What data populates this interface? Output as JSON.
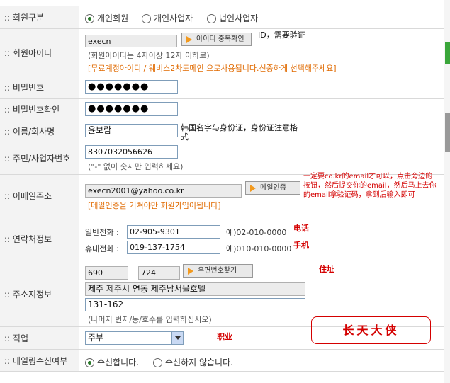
{
  "rows": {
    "member_type": {
      "label": ":: 회원구분",
      "options": [
        "개인회원",
        "개인사업자",
        "법인사업자"
      ],
      "selected": "개인회원"
    },
    "member_id": {
      "label": ":: 회원아이디",
      "value": "execn",
      "button": "아이디 중복확인",
      "hint": "(회원아이디는 4자이상 12자 이하로)",
      "warning": "[무료계정아이디 / 웨비스2차도메인 으로사용됩니다.신중하게 선택해주세요]",
      "annotation": "ID，需要验证"
    },
    "password": {
      "label": ":: 비밀번호",
      "value": "●●●●●●●"
    },
    "password_confirm": {
      "label": ":: 비밀번호확인",
      "value": "●●●●●●●"
    },
    "name": {
      "label": ":: 이름/회사명",
      "value": "윤보람",
      "annotation": "韩国名字与身份证，身份证注意格式"
    },
    "resident_no": {
      "label": ":: 주민/사업자번호",
      "value": "8307032056626",
      "hint": "(\"-\" 없이 숫자만 입력하세요)"
    },
    "email": {
      "label": ":: 이메일주소",
      "value": "execn2001@yahoo.co.kr",
      "button": "메일인증",
      "warning": "[메일인증을 거쳐야만 회원가입이됩니다]",
      "annotation": "一定要co.kr的email才可以，点击旁边的按钮，然后提交你的email，然后马上去你的email拿验证码，拿到后输入即可"
    },
    "contact": {
      "label": ":: 연락처정보",
      "phone_label": "일반전화 :",
      "phone_value": "02-905-9301",
      "phone_example": "예)02-010-0000",
      "phone_note": "电话",
      "mobile_label": "휴대전화 :",
      "mobile_value": "019-137-1754",
      "mobile_example": "예)010-010-0000",
      "mobile_note": "手机"
    },
    "address": {
      "label": ":: 주소지정보",
      "zip1": "690",
      "zip_sep": "-",
      "zip2": "724",
      "button": "우편번호찾기",
      "address1": "제주 제주시 연동 제주남서울호텔",
      "address2": "131-162",
      "hint": "(나머지 번지/동/호수를 입력하십시오)",
      "annotation": "住址"
    },
    "job": {
      "label": ":: 직업",
      "selected": "주부",
      "annotation": "职业"
    },
    "mailing": {
      "label": ":: 메일링수신여부",
      "options": [
        "수신합니다.",
        "수신하지 않습니다."
      ],
      "selected": "수신합니다."
    }
  },
  "stamp": "长天大侠"
}
